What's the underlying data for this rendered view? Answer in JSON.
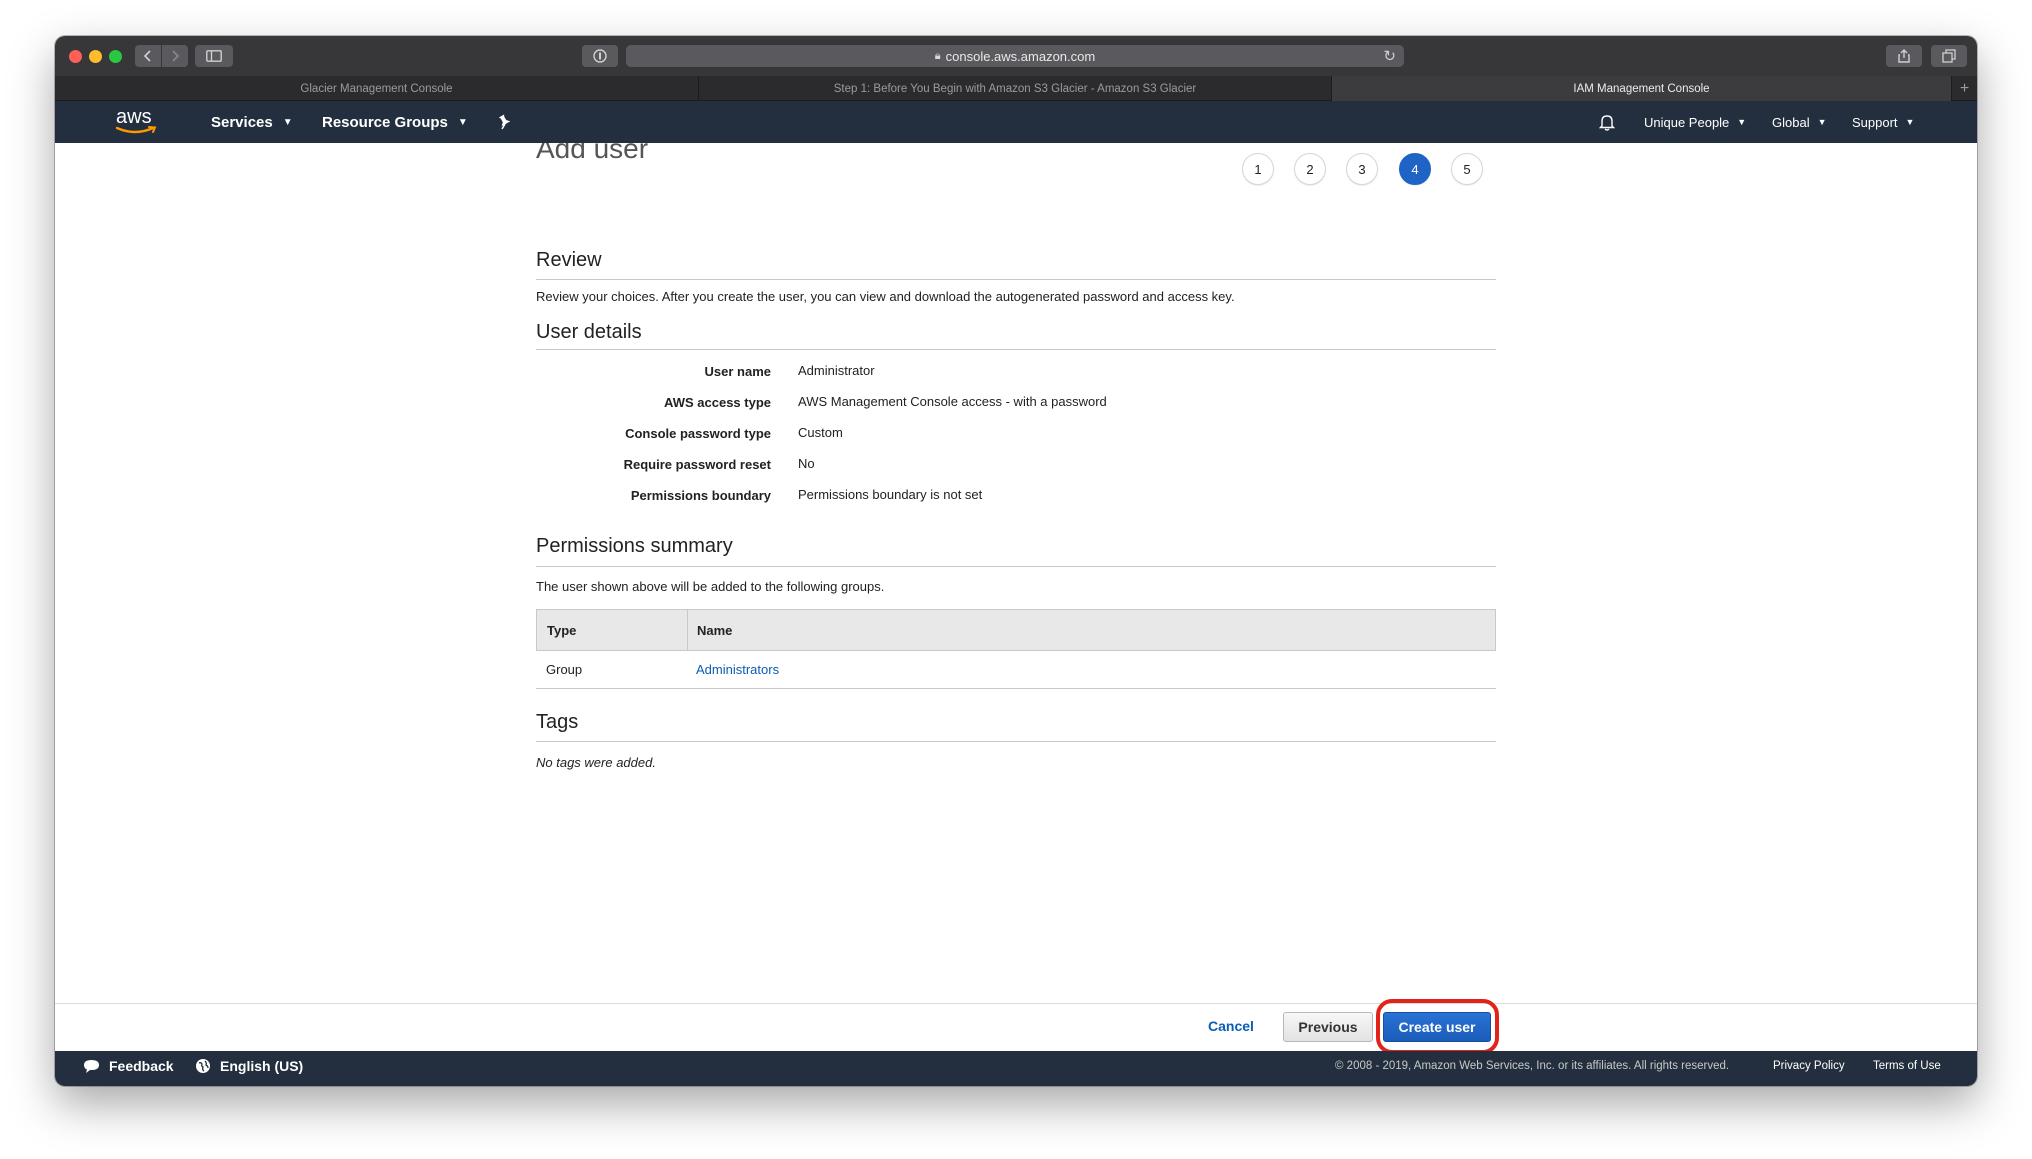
{
  "browser": {
    "url": "console.aws.amazon.com",
    "tabs": [
      {
        "label": "Glacier Management Console",
        "active": false
      },
      {
        "label": "Step 1: Before You Begin with Amazon S3 Glacier - Amazon S3 Glacier",
        "active": false
      },
      {
        "label": "IAM Management Console",
        "active": true
      }
    ],
    "icons": {
      "back": "chevron-left-icon",
      "forward": "chevron-right-icon",
      "sidebar": "sidebar-icon",
      "shield": "privacy-report-icon",
      "lock": "lock-icon",
      "reload": "reload-icon",
      "share": "share-icon",
      "tabs": "tab-overview-icon",
      "new_tab": "plus-icon"
    }
  },
  "aws_nav": {
    "logo_text": "aws",
    "services_label": "Services",
    "resource_groups_label": "Resource Groups",
    "account_label": "Unique People",
    "region_label": "Global",
    "support_label": "Support",
    "icons": {
      "pin": "pin-icon",
      "bell": "bell-icon",
      "chevron": "chevron-down-icon"
    },
    "colors": {
      "bar": "#232f3e",
      "logo_smile": "#ff9900"
    }
  },
  "page": {
    "title": "Add user",
    "steps": [
      "1",
      "2",
      "3",
      "4",
      "5"
    ],
    "active_step": "4",
    "review": {
      "title": "Review",
      "description": "Review your choices. After you create the user, you can view and download the autogenerated password and access key."
    },
    "user_details": {
      "title": "User details",
      "rows": [
        {
          "label": "User name",
          "value": "Administrator"
        },
        {
          "label": "AWS access type",
          "value": "AWS Management Console access - with a password"
        },
        {
          "label": "Console password type",
          "value": "Custom"
        },
        {
          "label": "Require password reset",
          "value": "No"
        },
        {
          "label": "Permissions boundary",
          "value": "Permissions boundary is not set"
        }
      ]
    },
    "permissions_summary": {
      "title": "Permissions summary",
      "description": "The user shown above will be added to the following groups.",
      "columns": [
        "Type",
        "Name"
      ],
      "rows": [
        {
          "type": "Group",
          "name": "Administrators"
        }
      ]
    },
    "tags": {
      "title": "Tags",
      "empty_text": "No tags were added."
    }
  },
  "actions": {
    "cancel_label": "Cancel",
    "previous_label": "Previous",
    "create_label": "Create user",
    "colors": {
      "primary": "#1f63c4",
      "link": "#0b5cb5",
      "highlight": "#e2231a"
    }
  },
  "footer": {
    "feedback_label": "Feedback",
    "language_label": "English (US)",
    "copyright": "© 2008 - 2019, Amazon Web Services, Inc. or its affiliates. All rights reserved.",
    "privacy_label": "Privacy Policy",
    "terms_label": "Terms of Use",
    "icons": {
      "feedback": "speech-bubble-icon",
      "language": "globe-icon"
    }
  }
}
